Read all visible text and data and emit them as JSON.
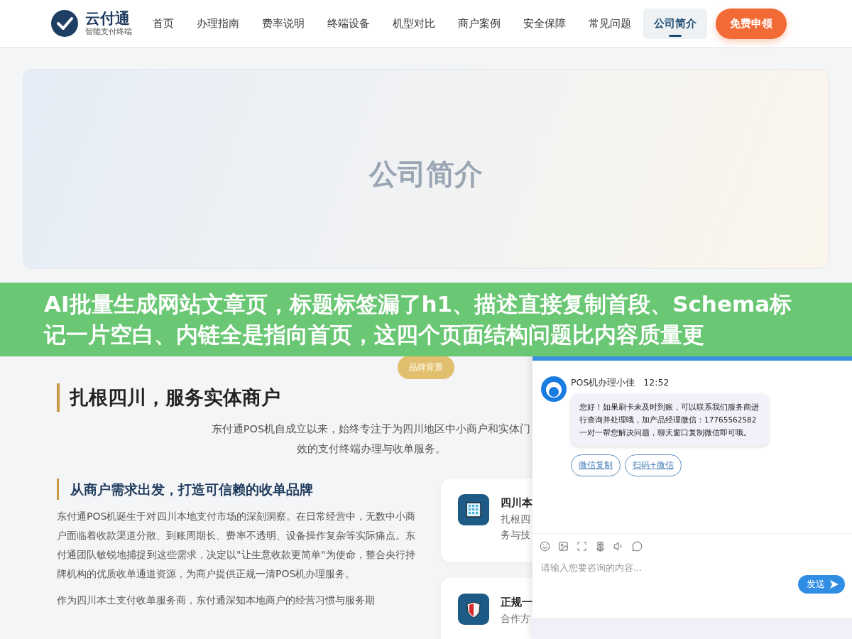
{
  "header": {
    "logo": {
      "name": "云付通",
      "tagline": "智能支付终端"
    },
    "nav": [
      {
        "label": "首页",
        "selected": false
      },
      {
        "label": "办理指南",
        "selected": false
      },
      {
        "label": "费率说明",
        "selected": false
      },
      {
        "label": "终端设备",
        "selected": false
      },
      {
        "label": "机型对比",
        "selected": false
      },
      {
        "label": "商户案例",
        "selected": false
      },
      {
        "label": "安全保障",
        "selected": false
      },
      {
        "label": "常见问题",
        "selected": false
      },
      {
        "label": "公司简介",
        "selected": true
      }
    ],
    "cta": "免费申领"
  },
  "hero": {
    "title": "公司简介"
  },
  "banner": {
    "text": "AI批量生成网站文章页，标题标签漏了h1、描述直接复制首段、Schema标记一片空白、内链全是指向首页，这四个页面结构问题比内容质量更"
  },
  "section": {
    "badge": "品牌背景",
    "title": "扎根四川，服务实体商户",
    "intro": [
      "东付通POS机自成立以来，始终专注于为四川地区中小商户和实体门",
      "效的支付终端办理与收单服务。"
    ],
    "subtitle": "从商户需求出发，打造可信赖的收单品牌",
    "paragraphs": [
      "东付通POS机诞生于对四川本地支付市场的深刻洞察。在日常经营中，无数中小商户面临着收款渠道分散、到账周期长、费率不透明、设备操作复杂等实际痛点。东付通团队敏锐地捕捉到这些需求，决定以\"让生意收款更简单\"为使命，整合央行持牌机构的优质收单通道资源，为商户提供正规一清POS机办理服务。",
      "作为四川本土支付收单服务商，东付通深知本地商户的经营习惯与服务期"
    ],
    "cards": [
      {
        "kind": "building",
        "title": "四川本",
        "lines": [
          "扎根四",
          "务与技"
        ]
      },
      {
        "kind": "shield",
        "title": "正规一",
        "lines": [
          "合作方"
        ]
      }
    ]
  },
  "chat": {
    "agent": "POS机办理小佳",
    "time": "12:52",
    "message": "您好！如果刷卡未及时到账，可以联系我们服务商进行查询并处理哦，加产品经理微信：17765562582 一对一帮您解决问题，聊天窗口复制微信即可哦。",
    "quick_replies": [
      "微信复制",
      "扫码+微信"
    ],
    "placeholder": "请输入您要咨询的内容...",
    "send": "发送"
  }
}
